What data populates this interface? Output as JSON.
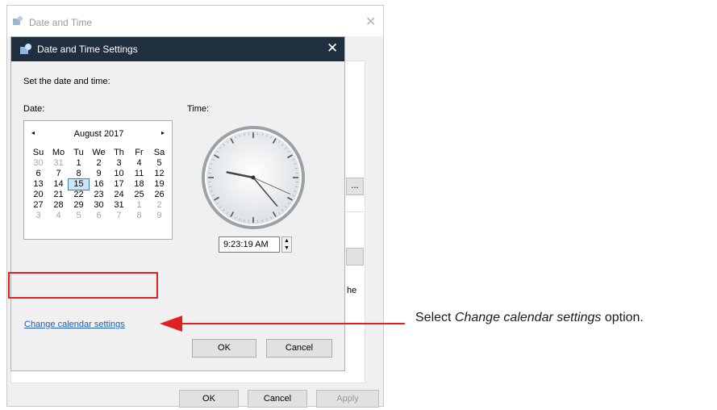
{
  "outer_window": {
    "title": "Date and Time",
    "close_symbol": "✕",
    "partial_button_label": "...",
    "partial_text": "he",
    "buttons": {
      "ok": "OK",
      "cancel": "Cancel",
      "apply": "Apply"
    }
  },
  "dialog": {
    "title": "Date and Time Settings",
    "close_symbol": "✕",
    "heading": "Set the date and time:",
    "date_label": "Date:",
    "time_label": "Time:",
    "calendar": {
      "prev_symbol": "◂",
      "next_symbol": "▸",
      "month_label": "August 2017",
      "weekdays": [
        "Su",
        "Mo",
        "Tu",
        "We",
        "Th",
        "Fr",
        "Sa"
      ],
      "weeks": [
        [
          {
            "d": "30",
            "dim": true
          },
          {
            "d": "31",
            "dim": true
          },
          {
            "d": "1"
          },
          {
            "d": "2"
          },
          {
            "d": "3"
          },
          {
            "d": "4"
          },
          {
            "d": "5"
          }
        ],
        [
          {
            "d": "6"
          },
          {
            "d": "7"
          },
          {
            "d": "8"
          },
          {
            "d": "9"
          },
          {
            "d": "10"
          },
          {
            "d": "11"
          },
          {
            "d": "12"
          }
        ],
        [
          {
            "d": "13"
          },
          {
            "d": "14"
          },
          {
            "d": "15",
            "selected": true
          },
          {
            "d": "16"
          },
          {
            "d": "17"
          },
          {
            "d": "18"
          },
          {
            "d": "19"
          }
        ],
        [
          {
            "d": "20"
          },
          {
            "d": "21"
          },
          {
            "d": "22"
          },
          {
            "d": "23"
          },
          {
            "d": "24"
          },
          {
            "d": "25"
          },
          {
            "d": "26"
          }
        ],
        [
          {
            "d": "27"
          },
          {
            "d": "28"
          },
          {
            "d": "29"
          },
          {
            "d": "30"
          },
          {
            "d": "31"
          },
          {
            "d": "1",
            "dim": true
          },
          {
            "d": "2",
            "dim": true
          }
        ],
        [
          {
            "d": "3",
            "dim": true
          },
          {
            "d": "4",
            "dim": true
          },
          {
            "d": "5",
            "dim": true
          },
          {
            "d": "6",
            "dim": true
          },
          {
            "d": "7",
            "dim": true
          },
          {
            "d": "8",
            "dim": true
          },
          {
            "d": "9",
            "dim": true
          }
        ]
      ]
    },
    "clock_time": {
      "hour": 9,
      "minute": 23,
      "second": 19
    },
    "time_value": "9:23:19 AM",
    "change_calendar_link": "Change calendar settings",
    "buttons": {
      "ok": "OK",
      "cancel": "Cancel"
    }
  },
  "annotation": {
    "prefix": "Select ",
    "emphasis": "Change calendar settings",
    "suffix": " option."
  },
  "colors": {
    "dialog_title_bg": "#1f2f3f",
    "highlight_red": "#e32020",
    "link_blue": "#1a5dbb"
  }
}
